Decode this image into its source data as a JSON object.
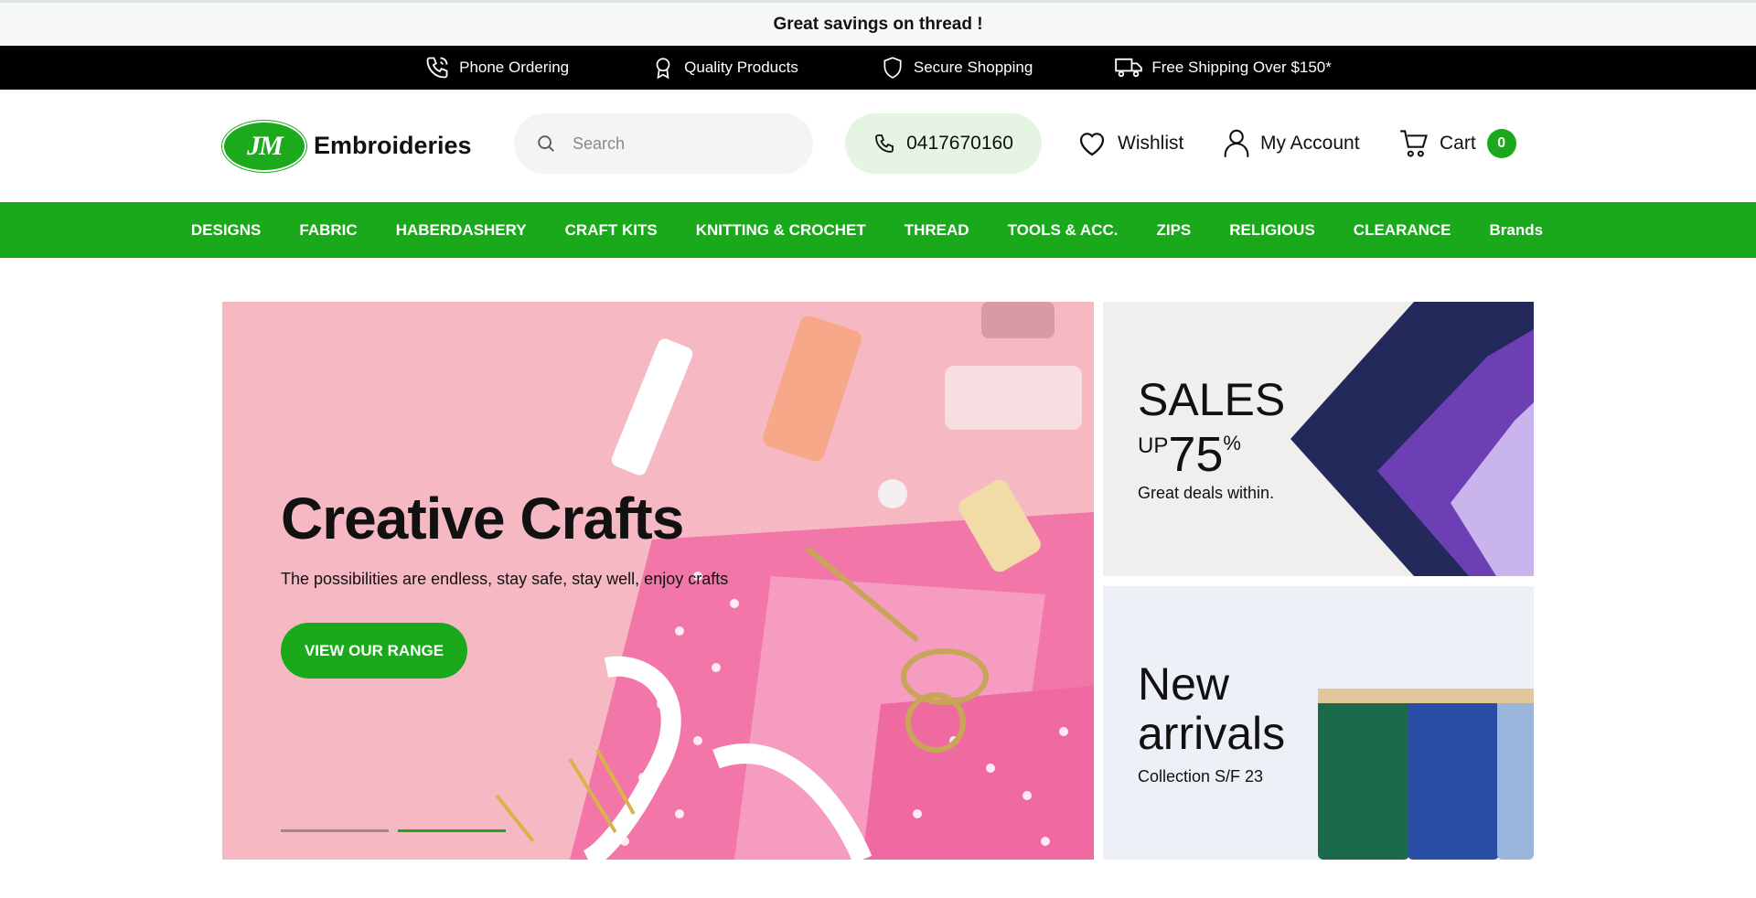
{
  "announcement": "Great savings on thread !",
  "usp": [
    {
      "icon": "phone-icon",
      "label": "Phone Ordering"
    },
    {
      "icon": "award-icon",
      "label": "Quality Products"
    },
    {
      "icon": "shield-icon",
      "label": "Secure Shopping"
    },
    {
      "icon": "truck-icon",
      "label": "Free Shipping Over $150*"
    }
  ],
  "header": {
    "logo_mark": "JM",
    "logo_text": "Embroideries",
    "search_placeholder": "Search",
    "phone": "0417670160",
    "wishlist": "Wishlist",
    "account": "My Account",
    "cart": "Cart",
    "cart_count": "0"
  },
  "nav": [
    "DESIGNS",
    "FABRIC",
    "HABERDASHERY",
    "CRAFT KITS",
    "KNITTING & CROCHET",
    "THREAD",
    "TOOLS & ACC.",
    "ZIPS",
    "RELIGIOUS",
    "CLEARANCE",
    "Brands"
  ],
  "hero": {
    "title": "Creative Crafts",
    "subtitle": "The possibilities are endless, stay safe, stay well, enjoy crafts",
    "button": "VIEW OUR RANGE",
    "slides": 2,
    "active_slide": 2
  },
  "promo_sales": {
    "title": "SALES",
    "up": "UP",
    "percent": "75",
    "percent_sign": "%",
    "subtitle": "Great deals within."
  },
  "promo_new": {
    "title_line1": "New",
    "title_line2": "arrivals",
    "subtitle": "Collection S/F 23"
  },
  "colors": {
    "brand_green": "#1aa91a",
    "hero_pink": "#f6b8c3",
    "top_bar": "#000000"
  }
}
